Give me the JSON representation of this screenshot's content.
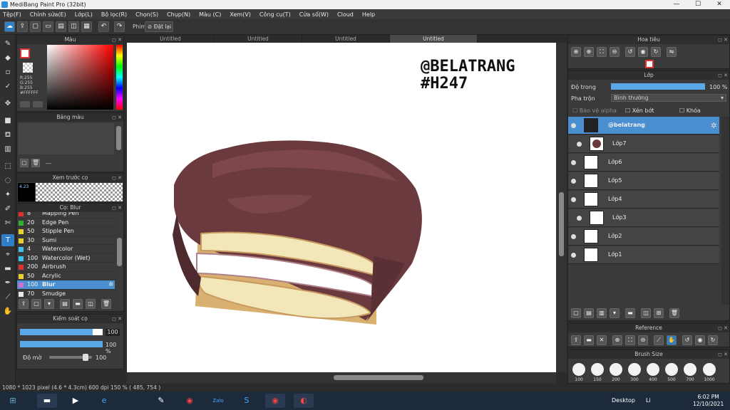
{
  "window": {
    "title": "MediBang Paint Pro (32bit)",
    "controls": [
      "—",
      "☐",
      "✕"
    ]
  },
  "menu": [
    "Tệp(F)",
    "Chỉnh sửa(E)",
    "Lớp(L)",
    "Bộ lọc(R)",
    "Chọn(S)",
    "Chụp(N)",
    "Màu (C)",
    "Xem(V)",
    "Công cụ(T)",
    "Cửa sổ(W)",
    "Cloud",
    "Help"
  ],
  "toolbar": {
    "key_label": "Phím",
    "reset_label": "Đặt lại"
  },
  "tabs": [
    "Untitled",
    "Untitled",
    "Untitled",
    "Untitled"
  ],
  "color_panel": {
    "title": "Màu",
    "r": "R:255",
    "g": "G:255",
    "b": "B:255",
    "hex": "#FFFFFF"
  },
  "palette_panel": {
    "title": "Bảng màu",
    "empty": "---"
  },
  "preview_panel": {
    "title": "Xem trước cọ",
    "size": "4.23"
  },
  "brush_panel": {
    "title": "Cọ: Blur",
    "items": [
      {
        "size": "8",
        "name": "Mapping Pen",
        "color": "#e03030"
      },
      {
        "size": "20",
        "name": "Edge Pen",
        "color": "#30b030"
      },
      {
        "size": "50",
        "name": "Stipple Pen",
        "color": "#e8d030"
      },
      {
        "size": "30",
        "name": "Sumi",
        "color": "#e8d030"
      },
      {
        "size": "4",
        "name": "Watercolor",
        "color": "#40c0f0"
      },
      {
        "size": "100",
        "name": "Watercolor (Wet)",
        "color": "#40c0f0"
      },
      {
        "size": "200",
        "name": "Airbrush",
        "color": "#e03030"
      },
      {
        "size": "50",
        "name": "Acrylic",
        "color": "#e8d030"
      },
      {
        "size": "100",
        "name": "Blur",
        "color": "#d070d0",
        "selected": true
      },
      {
        "size": "70",
        "name": "Smudge",
        "color": "#e8e8e8"
      }
    ]
  },
  "brush_control": {
    "title": "Kiểm soát cọ",
    "size_value": "100",
    "opacity_value": "100 %",
    "density_label": "Độ mờ",
    "density_value": "100",
    "size_frac": 0.88,
    "opacity_frac": 1.0,
    "density_frac": 0.9
  },
  "canvas": {
    "watermark_line1": "@BELATRANG",
    "watermark_line2": "#H247"
  },
  "navigator": {
    "title": "Hoa tiêu"
  },
  "layer_panel": {
    "title": "Lớp",
    "opacity_label": "Độ trong",
    "opacity_value": "100 %",
    "blend_label": "Pha trộn",
    "blend_value": "Bình thường",
    "protect_alpha": "Bảo vệ alpha",
    "clipping": "Xén bớt",
    "lock": "Khóa",
    "layers": [
      {
        "name": "@belatrang",
        "selected": true,
        "folder": true
      },
      {
        "name": "Lớp7",
        "indent": true
      },
      {
        "name": "Lớp6"
      },
      {
        "name": "Lớp5"
      },
      {
        "name": "Lớp4"
      },
      {
        "name": "Lớp3",
        "indent": true
      },
      {
        "name": "Lớp2"
      },
      {
        "name": "Lớp1"
      }
    ]
  },
  "reference_panel": {
    "title": "Reference"
  },
  "brush_size_panel": {
    "title": "Brush Size",
    "sizes": [
      "100",
      "150",
      "200",
      "300",
      "400",
      "500",
      "700",
      "1000"
    ]
  },
  "status": {
    "text": "1080 * 1023 pixel  (4.6 * 4.3cm)  600 dpi  150 %  ( 485, 754 )"
  },
  "taskbar": {
    "desktop_label": "Desktop",
    "lang": "Li",
    "time": "6:02 PM",
    "date": "12/10/2021"
  },
  "colors": {
    "accent": "#4a8fd0",
    "chocolate": "#6b3a3e",
    "cream": "#f3e6b8",
    "cake": "#d8b070"
  }
}
